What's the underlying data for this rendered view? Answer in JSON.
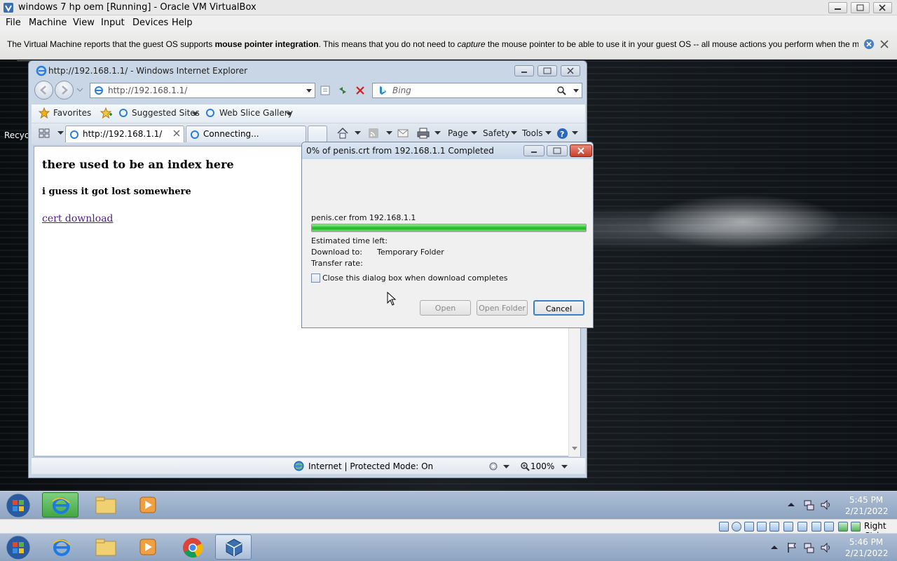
{
  "host": {
    "title": "windows 7 hp oem [Running] - Oracle VM VirtualBox",
    "menu": [
      "File",
      "Machine",
      "View",
      "Input",
      "Devices",
      "Help"
    ],
    "notice_pre": "The Virtual Machine reports that the guest OS supports ",
    "notice_bold": "mouse pointer integration",
    "notice_mid": ". This means that you do not need to ",
    "notice_em": "capture",
    "notice_post": " the mouse pointer to be able to use it in your guest OS -- all mouse actions you perform when the mouse pointer is over",
    "statusbar_key": "Right Ctrl",
    "clock_time": "5:46 PM",
    "clock_date": "2/21/2022"
  },
  "guest": {
    "recycle_label": "Recyc",
    "clock_time": "5:45 PM",
    "clock_date": "2/21/2022"
  },
  "ie": {
    "window_title": "http://192.168.1.1/ - Windows Internet Explorer",
    "address": "http://192.168.1.1/",
    "search_placeholder": "Bing",
    "favorites_label": "Favorites",
    "suggested_sites": "Suggested Sites",
    "web_slice_gallery": "Web Slice Gallery",
    "tabs": [
      {
        "label": "http://192.168.1.1/",
        "active": true
      },
      {
        "label": "Connecting...",
        "active": false
      }
    ],
    "commands": [
      "Page",
      "Safety",
      "Tools"
    ],
    "page": {
      "heading": "there used to be an index here",
      "subheading": "i guess it got lost somewhere",
      "link": "cert download"
    },
    "status_zone": "Internet | Protected Mode: On",
    "zoom": "100%"
  },
  "download_dialog": {
    "title": "0% of penis.crt from 192.168.1.1 Completed",
    "file_line": "penis.cer from 192.168.1.1",
    "progress": 1.0,
    "estimated_time_label": "Estimated time left:",
    "download_to_label": "Download to:",
    "download_to_value": "Temporary Folder",
    "transfer_rate_label": "Transfer rate:",
    "close_checkbox_label": "Close this dialog box when download completes",
    "close_checkbox_checked": false,
    "buttons": {
      "open": "Open",
      "open_folder": "Open Folder",
      "cancel": "Cancel"
    }
  },
  "colors": {
    "progress_green": "#2ec22e",
    "visited_link": "#551a8b",
    "taskbar": "#9fb3cc"
  }
}
